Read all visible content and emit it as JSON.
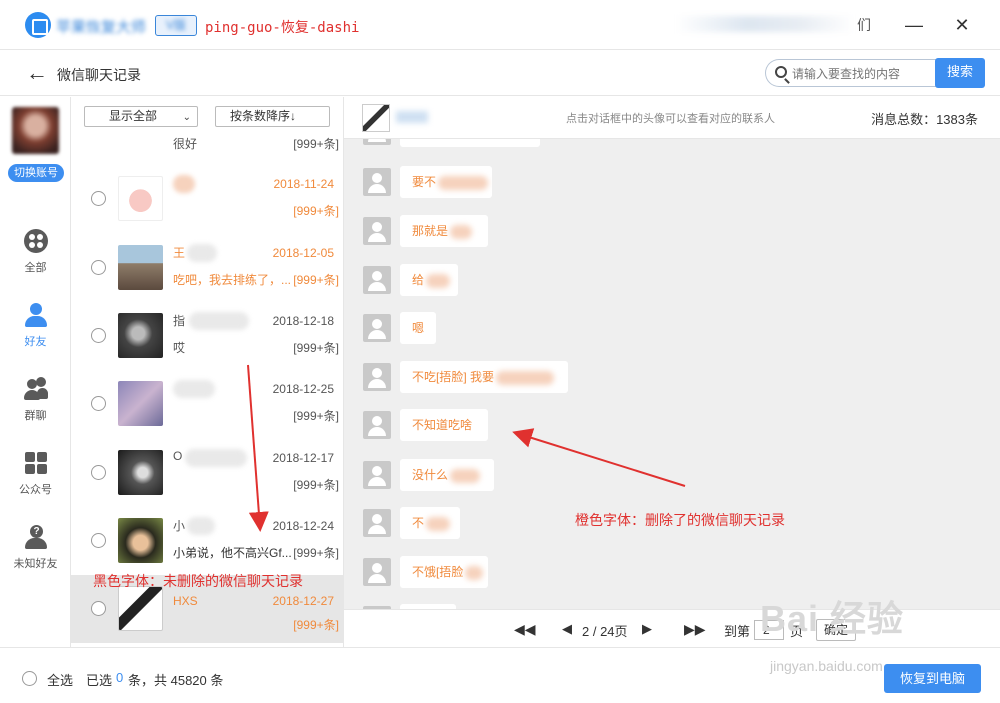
{
  "titlebar": {
    "app_name": "苹果恢复大师",
    "version_badge": "V版",
    "watermark": "ping-guo-恢复-dashi",
    "user_tail": "们",
    "min_icon": "minimize-icon",
    "close_icon": "close-icon"
  },
  "nav": {
    "title": "微信聊天记录",
    "search_placeholder": "请输入要查找的内容",
    "search_button": "搜索"
  },
  "sidebar": {
    "switch_account": "切换账号",
    "items": [
      {
        "label": "全部",
        "icon": "grid-icon",
        "active": false
      },
      {
        "label": "好友",
        "icon": "person-icon",
        "active": true
      },
      {
        "label": "群聊",
        "icon": "group-icon",
        "active": false
      },
      {
        "label": "公众号",
        "icon": "apps-icon",
        "active": false
      },
      {
        "label": "未知好友",
        "icon": "unknown-person-icon",
        "active": false
      }
    ]
  },
  "contacts": {
    "filter_show": "显示全部",
    "filter_sort": "按条数降序↓",
    "rows": [
      {
        "name": "",
        "date": "",
        "msg": "很好",
        "count": "[999+条]",
        "deleted": false
      },
      {
        "name": "",
        "date": "2018-11-24",
        "msg": "",
        "count": "[999+条]",
        "deleted": true
      },
      {
        "name": "王",
        "date": "2018-12-05",
        "msg": "吃吧，我去排练了，...",
        "count": "[999+条]",
        "deleted": true
      },
      {
        "name": "指",
        "date": "2018-12-18",
        "msg": "哎",
        "count": "[999+条]",
        "deleted": false
      },
      {
        "name": "名",
        "date": "2018-12-25",
        "msg": "",
        "count": "[999+条]",
        "deleted": false
      },
      {
        "name": "O",
        "date": "2018-12-17",
        "msg": "",
        "count": "[999+条]",
        "deleted": false
      },
      {
        "name": "小",
        "date": "2018-12-24",
        "msg": "小弟说，他不高兴Gf...",
        "count": "[999+条]",
        "deleted": false
      },
      {
        "name": "HXS",
        "date": "2018-12-27",
        "msg": "",
        "count": "[999+条]",
        "deleted": true
      }
    ]
  },
  "chat": {
    "hint": "点击对话框中的头像可以查看对应的联系人",
    "total": "消息总数：1383条",
    "messages": [
      {
        "text": "要不",
        "width": 92
      },
      {
        "text": "那就是",
        "width": 88
      },
      {
        "text": "给",
        "width": 58
      },
      {
        "text": "嗯",
        "width": 36
      },
      {
        "text": "不吃[捂脸] 我要",
        "width": 168
      },
      {
        "text": "不知道吃啥",
        "width": 88
      },
      {
        "text": "没什么",
        "width": 94
      },
      {
        "text": "不",
        "width": 60
      },
      {
        "text": "不饿[捂脸",
        "width": 88
      }
    ]
  },
  "pager": {
    "page_info": "2 / 24页",
    "goto_label": "到第",
    "goto_value": "2",
    "page_unit": "页",
    "confirm": "确定"
  },
  "bottom": {
    "select_all": "全选",
    "selected_prefix": "已选",
    "selected_count": "0",
    "selected_suffix": "条，共 45820 条",
    "restore_button": "恢复到电脑"
  },
  "annotations": {
    "black_note": "黑色字体：未删除的微信聊天记录",
    "orange_note": "橙色字体：删除了的微信聊天记录",
    "baidu_logo": "Bai 经验",
    "baidu_url": "jingyan.baidu.com"
  },
  "colors": {
    "accent": "#3d8ef0",
    "deleted_text": "#f08a3c",
    "annotation": "#e0312f"
  }
}
